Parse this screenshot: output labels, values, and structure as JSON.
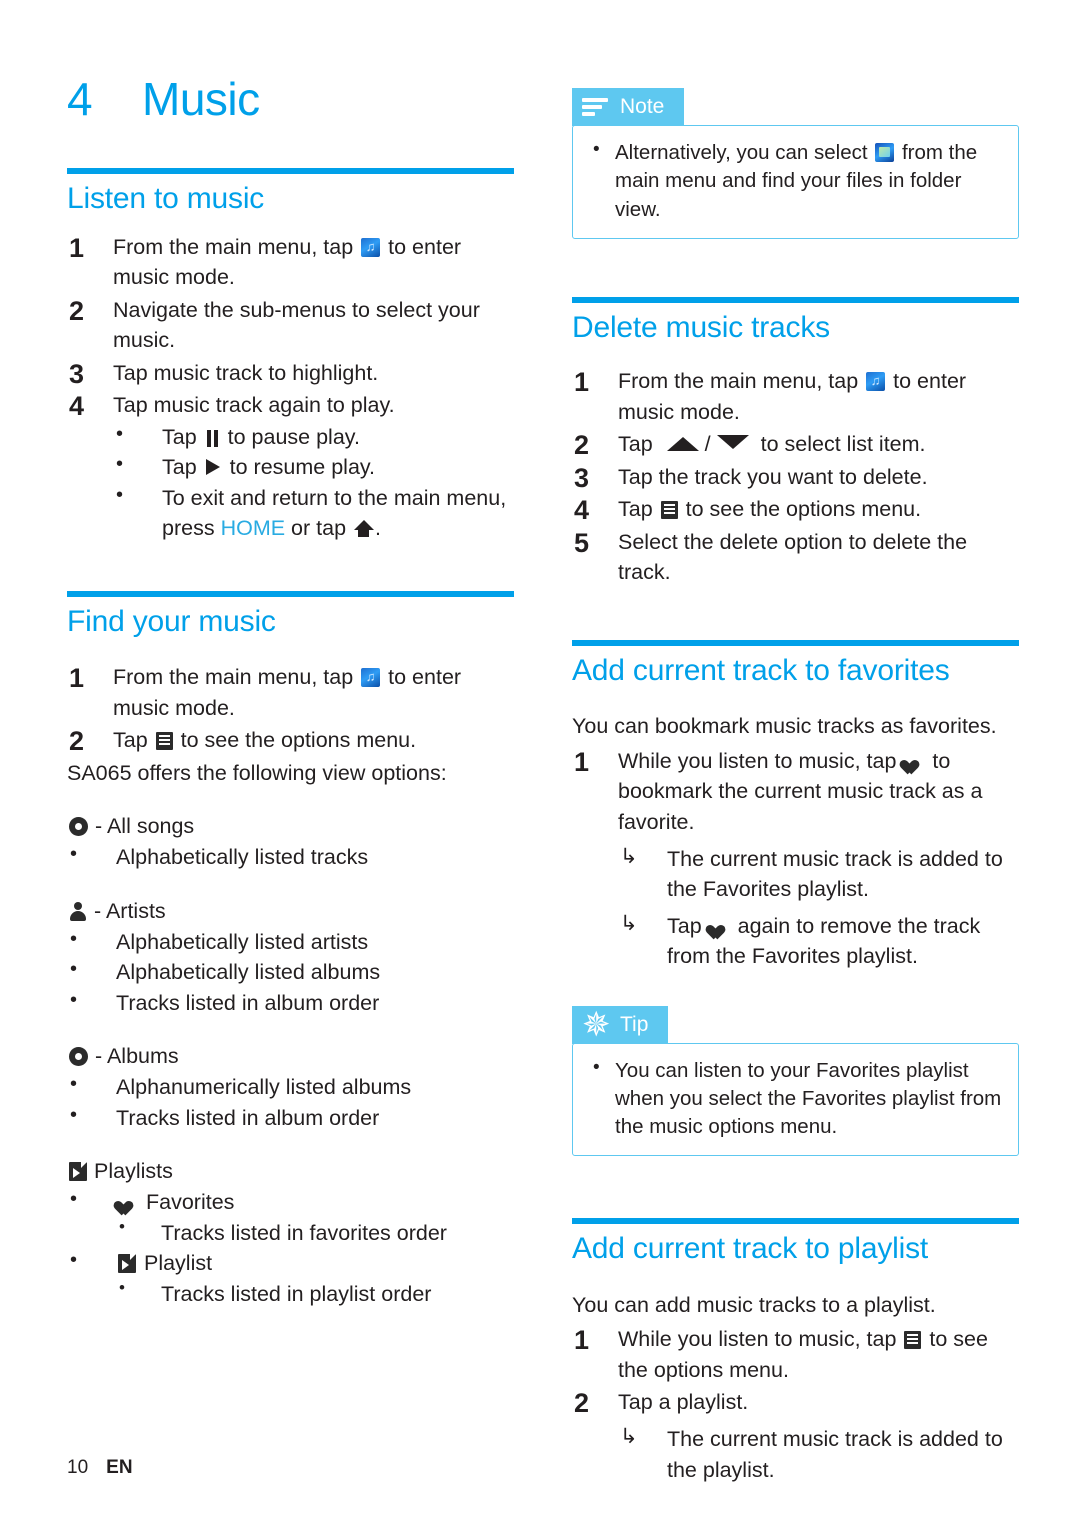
{
  "chapter": {
    "number": "4",
    "title": "Music"
  },
  "footer": {
    "page": "10",
    "lang": "EN"
  },
  "colors": {
    "accent": "#00a0e9",
    "callout": "#5ec8f0",
    "text": "#231f20"
  },
  "left": {
    "listen": {
      "heading": "Listen to music",
      "steps": [
        {
          "n": "1",
          "pre": "From the main menu, tap",
          "icon": "music-icon",
          "post": "to enter music mode."
        },
        {
          "n": "2",
          "pre": "Navigate the sub-menus to select your music.",
          "icon": "",
          "post": ""
        },
        {
          "n": "3",
          "pre": "Tap music track to highlight.",
          "icon": "",
          "post": ""
        },
        {
          "n": "4",
          "pre": "Tap music track again to play.",
          "icon": "",
          "post": ""
        }
      ],
      "bullets": [
        {
          "pre": "Tap",
          "icon": "pause-icon",
          "post": "to pause play."
        },
        {
          "pre": "Tap",
          "icon": "play-icon",
          "post": "to resume play."
        },
        {
          "pre": "To exit and return to the main menu, press",
          "keyword": "HOME",
          "mid": "or tap",
          "icon": "home-icon",
          "post": "."
        }
      ]
    },
    "find": {
      "heading": "Find your music",
      "steps": [
        {
          "n": "1",
          "pre": "From the main menu, tap",
          "icon": "music-icon",
          "post": "to enter music mode."
        },
        {
          "n": "2",
          "pre": "Tap",
          "icon": "options-menu-icon",
          "post": "to see the options menu."
        }
      ],
      "intro": "SA065 offers the following view options:",
      "groups": [
        {
          "icon": "disc-icon",
          "label": "- All songs",
          "items": [
            "Alphabetically listed tracks"
          ]
        },
        {
          "icon": "person-icon",
          "label": "- Artists",
          "items": [
            "Alphabetically listed artists",
            "Alphabetically listed albums",
            "Tracks listed in album order"
          ]
        },
        {
          "icon": "disc-icon",
          "label": "- Albums",
          "items": [
            "Alphanumerically listed albums",
            "Tracks listed in album order"
          ]
        }
      ],
      "playlists": {
        "icon": "playlist-icon",
        "label": "Playlists",
        "children": [
          {
            "icon": "heart-icon",
            "label": "Favorites",
            "sub": [
              "Tracks listed in favorites order"
            ]
          },
          {
            "icon": "playlist-icon",
            "label": "Playlist",
            "sub": [
              "Tracks listed in playlist order"
            ]
          }
        ]
      }
    }
  },
  "right": {
    "note": {
      "tab_icon": "note-icon",
      "tab_label": "Note",
      "items": [
        {
          "pre": "Alternatively, you can select",
          "icon": "folder-icon",
          "post": "from the main menu and find your files in folder view."
        }
      ]
    },
    "delete": {
      "heading": "Delete music tracks",
      "steps": [
        {
          "n": "1",
          "pre": "From the main menu, tap",
          "icon": "music-icon",
          "post": "to enter music mode."
        },
        {
          "n": "2",
          "pre": "Tap",
          "icon": "up-down-icon",
          "post": "to select list item."
        },
        {
          "n": "3",
          "pre": "Tap the track you want to delete.",
          "icon": "",
          "post": ""
        },
        {
          "n": "4",
          "pre": "Tap",
          "icon": "options-menu-icon",
          "post": "to see the options menu."
        },
        {
          "n": "5",
          "pre": "Select the delete option to delete the track.",
          "icon": "",
          "post": ""
        }
      ]
    },
    "favorites": {
      "heading": "Add current track to favorites",
      "intro": "You can bookmark music tracks as favorites.",
      "steps": [
        {
          "n": "1",
          "pre": "While you listen to music, tap",
          "icon": "heart-icon",
          "post": "to bookmark the current music track as a favorite."
        }
      ],
      "results": [
        {
          "pre": "The current music track is added to the Favorites playlist.",
          "icon": "",
          "post": ""
        },
        {
          "pre": "Tap",
          "icon": "heart-icon",
          "post": "again to remove the track from the Favorites playlist."
        }
      ]
    },
    "tip": {
      "tab_icon": "tip-icon",
      "tab_label": "Tip",
      "items": [
        {
          "pre": "You can listen to your Favorites playlist when you select the Favorites playlist from the music options menu.",
          "icon": "",
          "post": ""
        }
      ]
    },
    "playlist": {
      "heading": "Add current track to playlist",
      "intro": "You can add music tracks to a playlist.",
      "steps": [
        {
          "n": "1",
          "pre": "While you listen to music, tap",
          "icon": "options-menu-icon",
          "post": "to see the options menu."
        },
        {
          "n": "2",
          "pre": "Tap a playlist.",
          "icon": "",
          "post": ""
        }
      ],
      "results": [
        {
          "pre": "The current music track is added to the playlist.",
          "icon": "",
          "post": ""
        }
      ]
    }
  }
}
